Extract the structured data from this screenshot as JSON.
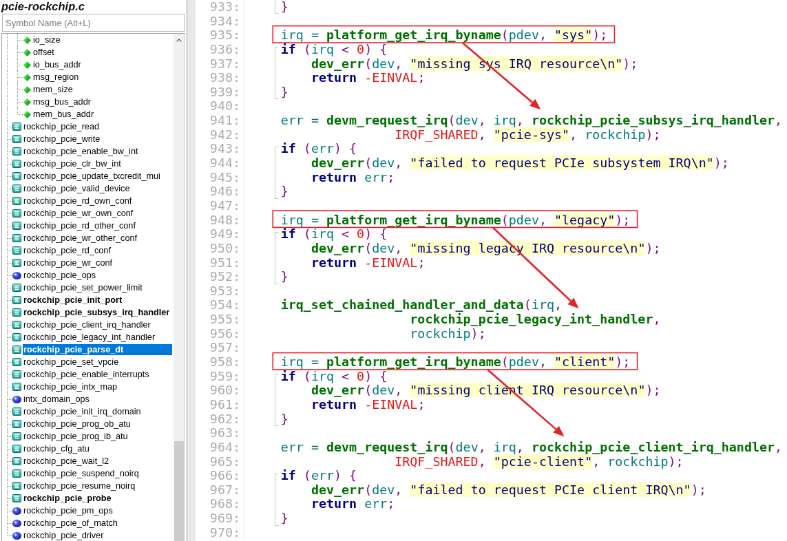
{
  "symbol_panel": {
    "title": "pcie-rockchip.c",
    "search": {
      "placeholder": "Symbol Name (Alt+L)"
    },
    "tree": [
      {
        "children": [
          {
            "label": "io_size",
            "kind": "member",
            "bold": false,
            "selected": false
          },
          {
            "label": "offset",
            "kind": "member",
            "bold": false,
            "selected": false
          },
          {
            "label": "io_bus_addr",
            "kind": "member",
            "bold": false,
            "selected": false
          },
          {
            "label": "msg_region",
            "kind": "member",
            "bold": false,
            "selected": false
          },
          {
            "label": "mem_size",
            "kind": "member",
            "bold": false,
            "selected": false
          },
          {
            "label": "msg_bus_addr",
            "kind": "member",
            "bold": false,
            "selected": false
          },
          {
            "label": "mem_bus_addr",
            "kind": "member",
            "bold": false,
            "selected": false
          }
        ]
      },
      {
        "label": "rockchip_pcie_read",
        "kind": "function",
        "bold": false,
        "selected": false
      },
      {
        "label": "rockchip_pcie_write",
        "kind": "function",
        "bold": false,
        "selected": false
      },
      {
        "label": "rockchip_pcie_enable_bw_int",
        "kind": "function",
        "bold": false,
        "selected": false
      },
      {
        "label": "rockchip_pcie_clr_bw_int",
        "kind": "function",
        "bold": false,
        "selected": false
      },
      {
        "label": "rockchip_pcie_update_txcredit_mui",
        "kind": "function",
        "bold": false,
        "selected": false
      },
      {
        "label": "rockchip_pcie_valid_device",
        "kind": "function",
        "bold": false,
        "selected": false
      },
      {
        "label": "rockchip_pcie_rd_own_conf",
        "kind": "function",
        "bold": false,
        "selected": false
      },
      {
        "label": "rockchip_pcie_wr_own_conf",
        "kind": "function",
        "bold": false,
        "selected": false
      },
      {
        "label": "rockchip_pcie_rd_other_conf",
        "kind": "function",
        "bold": false,
        "selected": false
      },
      {
        "label": "rockchip_pcie_wr_other_conf",
        "kind": "function",
        "bold": false,
        "selected": false
      },
      {
        "label": "rockchip_pcie_rd_conf",
        "kind": "function",
        "bold": false,
        "selected": false
      },
      {
        "label": "rockchip_pcie_wr_conf",
        "kind": "function",
        "bold": false,
        "selected": false
      },
      {
        "label": "rockchip_pcie_ops",
        "kind": "variable",
        "bold": false,
        "selected": false
      },
      {
        "label": "rockchip_pcie_set_power_limit",
        "kind": "function",
        "bold": false,
        "selected": false
      },
      {
        "label": "rockchip_pcie_init_port",
        "kind": "function",
        "bold": true,
        "selected": false
      },
      {
        "label": "rockchip_pcie_subsys_irq_handler",
        "kind": "function",
        "bold": true,
        "selected": false
      },
      {
        "label": "rockchip_pcie_client_irq_handler",
        "kind": "function",
        "bold": false,
        "selected": false
      },
      {
        "label": "rockchip_pcie_legacy_int_handler",
        "kind": "function",
        "bold": false,
        "selected": false
      },
      {
        "label": "rockchip_pcie_parse_dt",
        "kind": "function",
        "bold": true,
        "selected": true
      },
      {
        "label": "rockchip_pcie_set_vpcie",
        "kind": "function",
        "bold": false,
        "selected": false
      },
      {
        "label": "rockchip_pcie_enable_interrupts",
        "kind": "function",
        "bold": false,
        "selected": false
      },
      {
        "label": "rockchip_pcie_intx_map",
        "kind": "function",
        "bold": false,
        "selected": false
      },
      {
        "label": "intx_domain_ops",
        "kind": "variable",
        "bold": false,
        "selected": false
      },
      {
        "label": "rockchip_pcie_init_irq_domain",
        "kind": "function",
        "bold": false,
        "selected": false
      },
      {
        "label": "rockchip_pcie_prog_ob_atu",
        "kind": "function",
        "bold": false,
        "selected": false
      },
      {
        "label": "rockchip_pcie_prog_ib_atu",
        "kind": "function",
        "bold": false,
        "selected": false
      },
      {
        "label": "rockchip_cfg_atu",
        "kind": "function",
        "bold": false,
        "selected": false
      },
      {
        "label": "rockchip_pcie_wait_l2",
        "kind": "function",
        "bold": false,
        "selected": false
      },
      {
        "label": "rockchip_pcie_suspend_noirq",
        "kind": "function",
        "bold": false,
        "selected": false
      },
      {
        "label": "rockchip_pcie_resume_noirq",
        "kind": "function",
        "bold": false,
        "selected": false
      },
      {
        "label": "rockchip_pcie_probe",
        "kind": "function",
        "bold": true,
        "selected": false
      },
      {
        "label": "rockchip_pcie_pm_ops",
        "kind": "variable",
        "bold": false,
        "selected": false
      },
      {
        "label": "rockchip_pcie_of_match",
        "kind": "variable",
        "bold": false,
        "selected": false
      },
      {
        "label": "rockchip_pcie_driver",
        "kind": "variable",
        "bold": false,
        "selected": false
      }
    ]
  },
  "editor": {
    "lines": [
      {
        "number": "933:",
        "brace_guide": true,
        "boxed": false,
        "tokens": [
          {
            "text": "    }",
            "kind": "punct"
          }
        ]
      },
      {
        "number": "934:",
        "brace_guide": false,
        "boxed": false
      },
      {
        "number": "935:",
        "brace_guide": false,
        "boxed": true,
        "tokens": [
          {
            "text": "    irq",
            "kind": "var"
          },
          {
            "text": " = ",
            "kind": "op"
          },
          {
            "text": "platform_get_irq_byname",
            "kind": "func"
          },
          {
            "text": "(",
            "kind": "punct"
          },
          {
            "text": "pdev",
            "kind": "var"
          },
          {
            "text": ", ",
            "kind": "punct"
          },
          {
            "text": "\"sys\"",
            "kind": "str"
          },
          {
            "text": ");",
            "kind": "punct"
          }
        ]
      },
      {
        "number": "936:",
        "brace_guide": true,
        "boxed": false,
        "tokens": [
          {
            "text": "    if",
            "kind": "kw"
          },
          {
            "text": " (",
            "kind": "punct"
          },
          {
            "text": "irq",
            "kind": "var"
          },
          {
            "text": " < ",
            "kind": "punct"
          },
          {
            "text": "0",
            "kind": "const"
          },
          {
            "text": ") {",
            "kind": "punct"
          }
        ]
      },
      {
        "number": "937:",
        "brace_guide": true,
        "boxed": false,
        "tokens": [
          {
            "text": "        dev_err",
            "kind": "func"
          },
          {
            "text": "(",
            "kind": "punct"
          },
          {
            "text": "dev",
            "kind": "var"
          },
          {
            "text": ", ",
            "kind": "punct"
          },
          {
            "text": "\"missing sys IRQ resource\\n\"",
            "kind": "str"
          },
          {
            "text": ");",
            "kind": "punct"
          }
        ]
      },
      {
        "number": "938:",
        "brace_guide": true,
        "boxed": false,
        "tokens": [
          {
            "text": "        return",
            "kind": "kw"
          },
          {
            "text": " -EINVAL",
            "kind": "const"
          },
          {
            "text": ";",
            "kind": "punct"
          }
        ]
      },
      {
        "number": "939:",
        "brace_guide": true,
        "boxed": false,
        "tokens": [
          {
            "text": "    }",
            "kind": "punct"
          }
        ]
      },
      {
        "number": "940:",
        "brace_guide": false,
        "boxed": false
      },
      {
        "number": "941:",
        "brace_guide": false,
        "boxed": false,
        "tokens": [
          {
            "text": "    err",
            "kind": "var"
          },
          {
            "text": " = ",
            "kind": "op"
          },
          {
            "text": "devm_request_irq",
            "kind": "func"
          },
          {
            "text": "(",
            "kind": "punct"
          },
          {
            "text": "dev",
            "kind": "var"
          },
          {
            "text": ", ",
            "kind": "punct"
          },
          {
            "text": "irq",
            "kind": "var"
          },
          {
            "text": ", ",
            "kind": "punct"
          },
          {
            "text": "rockchip_pcie_subsys_irq_handler",
            "kind": "func"
          },
          {
            "text": ",",
            "kind": "punct"
          }
        ]
      },
      {
        "number": "942:",
        "brace_guide": false,
        "boxed": false,
        "tokens": [
          {
            "text": "                   IRQF_SHARED",
            "kind": "const"
          },
          {
            "text": ", ",
            "kind": "punct"
          },
          {
            "text": "\"pcie-sys\"",
            "kind": "str"
          },
          {
            "text": ", ",
            "kind": "punct"
          },
          {
            "text": "rockchip",
            "kind": "var"
          },
          {
            "text": ");",
            "kind": "punct"
          }
        ]
      },
      {
        "number": "943:",
        "brace_guide": true,
        "boxed": false,
        "tokens": [
          {
            "text": "    if",
            "kind": "kw"
          },
          {
            "text": " (",
            "kind": "punct"
          },
          {
            "text": "err",
            "kind": "var"
          },
          {
            "text": ") {",
            "kind": "punct"
          }
        ]
      },
      {
        "number": "944:",
        "brace_guide": true,
        "boxed": false,
        "tokens": [
          {
            "text": "        dev_err",
            "kind": "func"
          },
          {
            "text": "(",
            "kind": "punct"
          },
          {
            "text": "dev",
            "kind": "var"
          },
          {
            "text": ", ",
            "kind": "punct"
          },
          {
            "text": "\"failed to request PCIe subsystem IRQ\\n\"",
            "kind": "str"
          },
          {
            "text": ");",
            "kind": "punct"
          }
        ]
      },
      {
        "number": "945:",
        "brace_guide": true,
        "boxed": false,
        "tokens": [
          {
            "text": "        return",
            "kind": "kw"
          },
          {
            "text": " err",
            "kind": "var"
          },
          {
            "text": ";",
            "kind": "punct"
          }
        ]
      },
      {
        "number": "946:",
        "brace_guide": true,
        "boxed": false,
        "tokens": [
          {
            "text": "    }",
            "kind": "punct"
          }
        ]
      },
      {
        "number": "947:",
        "brace_guide": false,
        "boxed": false
      },
      {
        "number": "948:",
        "brace_guide": false,
        "boxed": true,
        "tokens": [
          {
            "text": "    irq",
            "kind": "var"
          },
          {
            "text": " = ",
            "kind": "op"
          },
          {
            "text": "platform_get_irq_byname",
            "kind": "func"
          },
          {
            "text": "(",
            "kind": "punct"
          },
          {
            "text": "pdev",
            "kind": "var"
          },
          {
            "text": ", ",
            "kind": "punct"
          },
          {
            "text": "\"legacy\"",
            "kind": "str"
          },
          {
            "text": ");",
            "kind": "punct"
          }
        ]
      },
      {
        "number": "949:",
        "brace_guide": true,
        "boxed": false,
        "tokens": [
          {
            "text": "    if",
            "kind": "kw"
          },
          {
            "text": " (",
            "kind": "punct"
          },
          {
            "text": "irq",
            "kind": "var"
          },
          {
            "text": " < ",
            "kind": "punct"
          },
          {
            "text": "0",
            "kind": "const"
          },
          {
            "text": ") {",
            "kind": "punct"
          }
        ]
      },
      {
        "number": "950:",
        "brace_guide": true,
        "boxed": false,
        "tokens": [
          {
            "text": "        dev_err",
            "kind": "func"
          },
          {
            "text": "(",
            "kind": "punct"
          },
          {
            "text": "dev",
            "kind": "var"
          },
          {
            "text": ", ",
            "kind": "punct"
          },
          {
            "text": "\"missing legacy IRQ resource\\n\"",
            "kind": "str"
          },
          {
            "text": ");",
            "kind": "punct"
          }
        ]
      },
      {
        "number": "951:",
        "brace_guide": true,
        "boxed": false,
        "tokens": [
          {
            "text": "        return",
            "kind": "kw"
          },
          {
            "text": " -EINVAL",
            "kind": "const"
          },
          {
            "text": ";",
            "kind": "punct"
          }
        ]
      },
      {
        "number": "952:",
        "brace_guide": true,
        "boxed": false,
        "tokens": [
          {
            "text": "    }",
            "kind": "punct"
          }
        ]
      },
      {
        "number": "953:",
        "brace_guide": false,
        "boxed": false
      },
      {
        "number": "954:",
        "brace_guide": false,
        "boxed": false,
        "tokens": [
          {
            "text": "    irq_set_chained_handler_and_data",
            "kind": "func"
          },
          {
            "text": "(",
            "kind": "punct"
          },
          {
            "text": "irq",
            "kind": "var"
          },
          {
            "text": ",",
            "kind": "punct"
          }
        ]
      },
      {
        "number": "955:",
        "brace_guide": false,
        "boxed": false,
        "tokens": [
          {
            "text": "                     rockchip_pcie_legacy_int_handler",
            "kind": "func"
          },
          {
            "text": ",",
            "kind": "punct"
          }
        ]
      },
      {
        "number": "956:",
        "brace_guide": false,
        "boxed": false,
        "tokens": [
          {
            "text": "                     rockchip",
            "kind": "var"
          },
          {
            "text": ");",
            "kind": "punct"
          }
        ]
      },
      {
        "number": "957:",
        "brace_guide": false,
        "boxed": false
      },
      {
        "number": "958:",
        "brace_guide": false,
        "boxed": true,
        "tokens": [
          {
            "text": "    irq",
            "kind": "var"
          },
          {
            "text": " = ",
            "kind": "op"
          },
          {
            "text": "platform_get_irq_byname",
            "kind": "func"
          },
          {
            "text": "(",
            "kind": "punct"
          },
          {
            "text": "pdev",
            "kind": "var"
          },
          {
            "text": ", ",
            "kind": "punct"
          },
          {
            "text": "\"client\"",
            "kind": "str"
          },
          {
            "text": ");",
            "kind": "punct"
          }
        ]
      },
      {
        "number": "959:",
        "brace_guide": true,
        "boxed": false,
        "tokens": [
          {
            "text": "    if",
            "kind": "kw"
          },
          {
            "text": " (",
            "kind": "punct"
          },
          {
            "text": "irq",
            "kind": "var"
          },
          {
            "text": " < ",
            "kind": "punct"
          },
          {
            "text": "0",
            "kind": "const"
          },
          {
            "text": ") {",
            "kind": "punct"
          }
        ]
      },
      {
        "number": "960:",
        "brace_guide": true,
        "boxed": false,
        "tokens": [
          {
            "text": "        dev_err",
            "kind": "func"
          },
          {
            "text": "(",
            "kind": "punct"
          },
          {
            "text": "dev",
            "kind": "var"
          },
          {
            "text": ", ",
            "kind": "punct"
          },
          {
            "text": "\"missing client IRQ resource\\n\"",
            "kind": "str"
          },
          {
            "text": ");",
            "kind": "punct"
          }
        ]
      },
      {
        "number": "961:",
        "brace_guide": true,
        "boxed": false,
        "tokens": [
          {
            "text": "        return",
            "kind": "kw"
          },
          {
            "text": " -EINVAL",
            "kind": "const"
          },
          {
            "text": ";",
            "kind": "punct"
          }
        ]
      },
      {
        "number": "962:",
        "brace_guide": true,
        "boxed": false,
        "tokens": [
          {
            "text": "    }",
            "kind": "punct"
          }
        ]
      },
      {
        "number": "963:",
        "brace_guide": false,
        "boxed": false
      },
      {
        "number": "964:",
        "brace_guide": false,
        "boxed": false,
        "tokens": [
          {
            "text": "    err",
            "kind": "var"
          },
          {
            "text": " = ",
            "kind": "op"
          },
          {
            "text": "devm_request_irq",
            "kind": "func"
          },
          {
            "text": "(",
            "kind": "punct"
          },
          {
            "text": "dev",
            "kind": "var"
          },
          {
            "text": ", ",
            "kind": "punct"
          },
          {
            "text": "irq",
            "kind": "var"
          },
          {
            "text": ", ",
            "kind": "punct"
          },
          {
            "text": "rockchip_pcie_client_irq_handler",
            "kind": "func"
          },
          {
            "text": ",",
            "kind": "punct"
          }
        ]
      },
      {
        "number": "965:",
        "brace_guide": false,
        "boxed": false,
        "tokens": [
          {
            "text": "                   IRQF_SHARED",
            "kind": "const"
          },
          {
            "text": ", ",
            "kind": "punct"
          },
          {
            "text": "\"pcie-client\"",
            "kind": "str"
          },
          {
            "text": ", ",
            "kind": "punct"
          },
          {
            "text": "rockchip",
            "kind": "var"
          },
          {
            "text": ");",
            "kind": "punct"
          }
        ]
      },
      {
        "number": "966:",
        "brace_guide": true,
        "boxed": false,
        "tokens": [
          {
            "text": "    if",
            "kind": "kw"
          },
          {
            "text": " (",
            "kind": "punct"
          },
          {
            "text": "err",
            "kind": "var"
          },
          {
            "text": ") {",
            "kind": "punct"
          }
        ]
      },
      {
        "number": "967:",
        "brace_guide": true,
        "boxed": false,
        "tokens": [
          {
            "text": "        dev_err",
            "kind": "func"
          },
          {
            "text": "(",
            "kind": "punct"
          },
          {
            "text": "dev",
            "kind": "var"
          },
          {
            "text": ", ",
            "kind": "punct"
          },
          {
            "text": "\"failed to request PCIe client IRQ\\n\"",
            "kind": "str"
          },
          {
            "text": ");",
            "kind": "punct"
          }
        ]
      },
      {
        "number": "968:",
        "brace_guide": true,
        "boxed": false,
        "tokens": [
          {
            "text": "        return",
            "kind": "kw"
          },
          {
            "text": " err",
            "kind": "var"
          },
          {
            "text": ";",
            "kind": "punct"
          }
        ]
      },
      {
        "number": "969:",
        "brace_guide": true,
        "boxed": false,
        "tokens": [
          {
            "text": "    }",
            "kind": "punct"
          }
        ]
      },
      {
        "number": "970:",
        "brace_guide": false,
        "boxed": false
      }
    ],
    "annotations": [
      {
        "kind": "arrow"
      },
      {
        "kind": "arrow"
      },
      {
        "kind": "arrow"
      }
    ]
  }
}
